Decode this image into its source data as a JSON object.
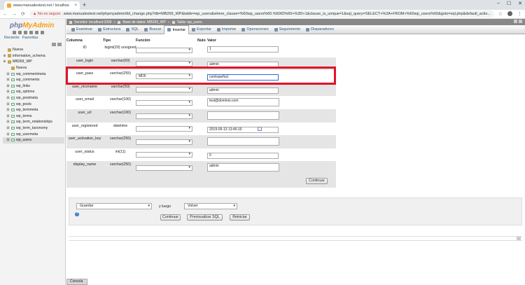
{
  "browser": {
    "tab_title": "www.manualestest.net / localhos",
    "tab_close": "×",
    "new_tab": "+",
    "window_controls": [
      "–",
      "☐",
      "✕"
    ],
    "security_warning": "▲ No es seguro",
    "url": "www.manualestest.net/phpmyadmin/tbl_change.php?db=MB269_WP&table=wp_users&where_clause=%60wp_users%60.%60ID%60+%3D+1&clause_is_unique=1&sql_query=SELECT+%2A+FROM+%60wp_users%60&goto=sql.php&default_actio..."
  },
  "leftnav": {
    "logo_php": "php",
    "logo_my": "MyAdmin",
    "tabs": [
      "Reciente",
      "Favoritas"
    ],
    "tree": [
      {
        "label": "Nueva",
        "kind": "new",
        "indent": 0
      },
      {
        "label": "information_schema",
        "kind": "db",
        "indent": 0
      },
      {
        "label": "MB269_WP",
        "kind": "db",
        "indent": 0
      },
      {
        "label": "Nueva",
        "kind": "new",
        "indent": 1
      },
      {
        "label": "wp_commentmeta",
        "kind": "table",
        "indent": 1
      },
      {
        "label": "wp_comments",
        "kind": "table",
        "indent": 1
      },
      {
        "label": "wp_links",
        "kind": "table",
        "indent": 1
      },
      {
        "label": "wp_options",
        "kind": "table",
        "indent": 1
      },
      {
        "label": "wp_postmeta",
        "kind": "table",
        "indent": 1
      },
      {
        "label": "wp_posts",
        "kind": "table",
        "indent": 1
      },
      {
        "label": "wp_termmeta",
        "kind": "table",
        "indent": 1
      },
      {
        "label": "wp_terms",
        "kind": "table",
        "indent": 1
      },
      {
        "label": "wp_term_relationships",
        "kind": "table",
        "indent": 1
      },
      {
        "label": "wp_term_taxonomy",
        "kind": "table",
        "indent": 1
      },
      {
        "label": "wp_usermeta",
        "kind": "table",
        "indent": 1
      },
      {
        "label": "wp_users",
        "kind": "table",
        "indent": 1,
        "selected": true
      }
    ]
  },
  "breadcrumb": {
    "server": "Servidor: localhost:3306",
    "database": "Base de datos: MB269_WP",
    "table": "Tabla: wp_users"
  },
  "tabs": [
    {
      "label": "Examinar",
      "active": false
    },
    {
      "label": "Estructura",
      "active": false
    },
    {
      "label": "SQL",
      "active": false
    },
    {
      "label": "Buscar",
      "active": false
    },
    {
      "label": "Insertar",
      "active": true
    },
    {
      "label": "Exportar",
      "active": false
    },
    {
      "label": "Importar",
      "active": false
    },
    {
      "label": "Operaciones",
      "active": false
    },
    {
      "label": "Seguimiento",
      "active": false
    },
    {
      "label": "Disparadores",
      "active": false
    }
  ],
  "form": {
    "headers": {
      "column": "Columna",
      "type": "Tipo",
      "function": "Función",
      "null": "Nulo",
      "value": "Valor"
    },
    "rows": [
      {
        "column": "ID",
        "type": "bigint(20) unsigned",
        "function": "",
        "value": "1",
        "textarea": false
      },
      {
        "column": "user_login",
        "type": "varchar(60)",
        "function": "",
        "value": "admin",
        "textarea": false
      },
      {
        "column": "user_pass",
        "type": "varchar(255)",
        "function": "MD5",
        "value": "contraseña1",
        "textarea": false
      },
      {
        "column": "user_nicename",
        "type": "varchar(50)",
        "function": "",
        "value": "admin",
        "textarea": false
      },
      {
        "column": "user_email",
        "type": "varchar(100)",
        "function": "",
        "value": "test@dominio.com",
        "textarea": true
      },
      {
        "column": "user_url",
        "type": "varchar(100)",
        "function": "",
        "value": "",
        "textarea": true
      },
      {
        "column": "user_registered",
        "type": "datetime",
        "function": "",
        "value": "2019-05-13 13:46:19",
        "textarea": false
      },
      {
        "column": "user_activation_key",
        "type": "varchar(255)",
        "function": "",
        "value": "",
        "textarea": true
      },
      {
        "column": "user_status",
        "type": "int(11)",
        "function": "",
        "value": "0",
        "textarea": false
      },
      {
        "column": "display_name",
        "type": "varchar(250)",
        "function": "",
        "value": "admin",
        "textarea": true
      }
    ],
    "continue_label": "Continuar"
  },
  "actions": {
    "save_option": "Guardar",
    "and_then": "y luego",
    "after_option": "Volver",
    "continue_label": "Continuar",
    "preview_label": "Previsualizar SQL",
    "reset_label": "Reiniciar"
  },
  "console_label": "Consola",
  "colors": {
    "highlight": "#e0142a",
    "link": "#235a81"
  }
}
